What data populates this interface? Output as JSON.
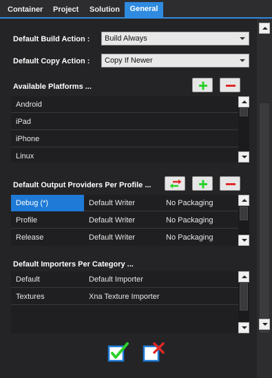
{
  "tabs": [
    {
      "label": "Container"
    },
    {
      "label": "Project"
    },
    {
      "label": "Solution"
    },
    {
      "label": "General",
      "active": true
    }
  ],
  "build_action": {
    "label": "Default Build Action :",
    "value": "Build Always"
  },
  "copy_action": {
    "label": "Default Copy Action :",
    "value": "Copy If Newer"
  },
  "platforms": {
    "label": "Available Platforms ...",
    "items": [
      "Android",
      "iPad",
      "iPhone",
      "Linux"
    ]
  },
  "output_providers": {
    "label": "Default Output Providers Per Profile ...",
    "rows": [
      {
        "profile": "Debug (*)",
        "writer": "Default Writer",
        "packaging": "No Packaging"
      },
      {
        "profile": "Profile",
        "writer": "Default Writer",
        "packaging": "No Packaging"
      },
      {
        "profile": "Release",
        "writer": "Default Writer",
        "packaging": "No Packaging"
      }
    ]
  },
  "importers": {
    "label": "Default Importers Per Category ...",
    "rows": [
      {
        "category": "Default",
        "importer": "Default Importer"
      },
      {
        "category": "Textures",
        "importer": "Xna Texture Importer"
      }
    ]
  },
  "colors": {
    "accent": "#2f8be0",
    "selection": "#1e7ad6",
    "add": "#2bd12b",
    "remove": "#e02828"
  },
  "icons": [
    "plus-icon",
    "minus-icon",
    "swap-icon",
    "checkbox-ok-icon",
    "checkbox-cancel-icon"
  ]
}
